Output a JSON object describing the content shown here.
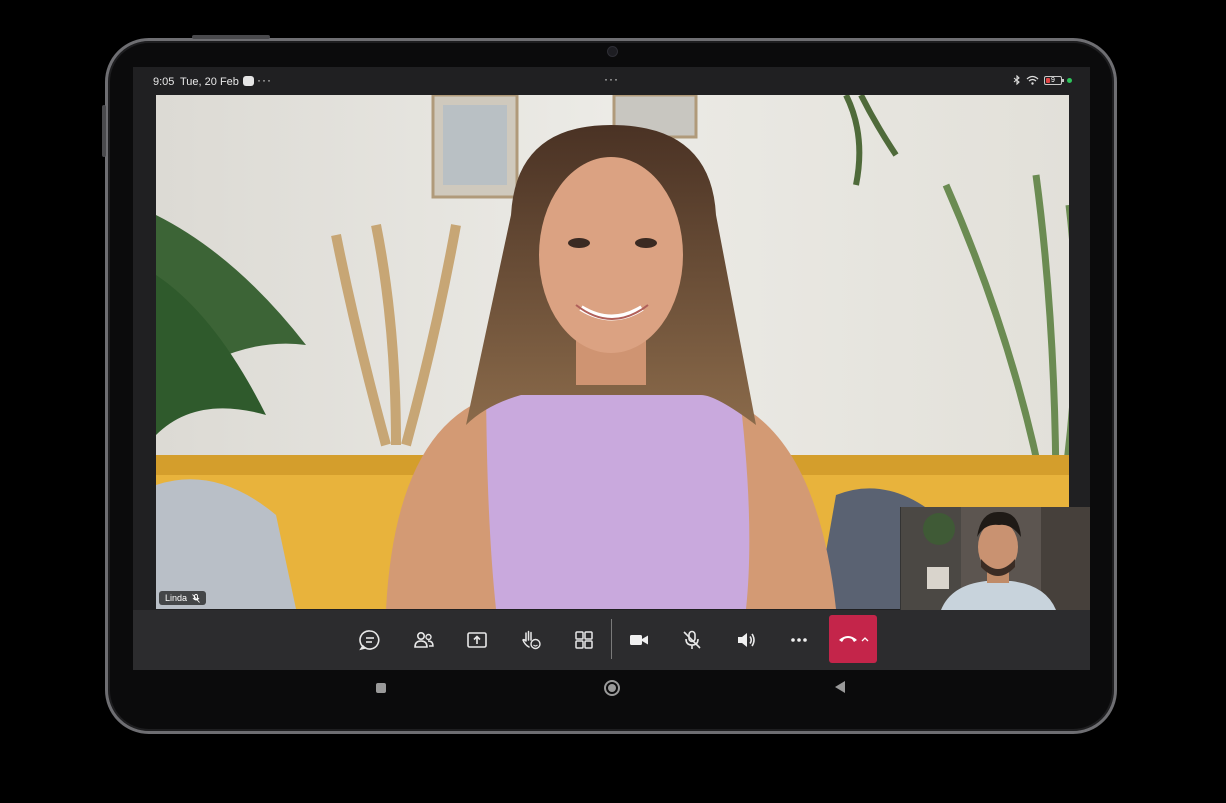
{
  "status_bar": {
    "time": "9:05",
    "date": "Tue, 20 Feb",
    "battery": "9",
    "icons": [
      "bluetooth-icon",
      "wifi-icon",
      "battery-icon"
    ]
  },
  "participants": {
    "main": {
      "name": "Linda",
      "muted_icon": "mic-off-icon"
    }
  },
  "call_controls": [
    {
      "name": "chat-icon"
    },
    {
      "name": "participants-icon"
    },
    {
      "name": "share-screen-icon"
    },
    {
      "name": "raise-hand-icon"
    },
    {
      "name": "layout-grid-icon"
    },
    {
      "name": "camera-icon"
    },
    {
      "name": "mic-off-icon"
    },
    {
      "name": "speaker-icon"
    },
    {
      "name": "more-icon"
    },
    {
      "name": "hang-up-icon"
    }
  ],
  "colors": {
    "hangup": "#c4254a",
    "status_ok": "#2ec45c"
  }
}
